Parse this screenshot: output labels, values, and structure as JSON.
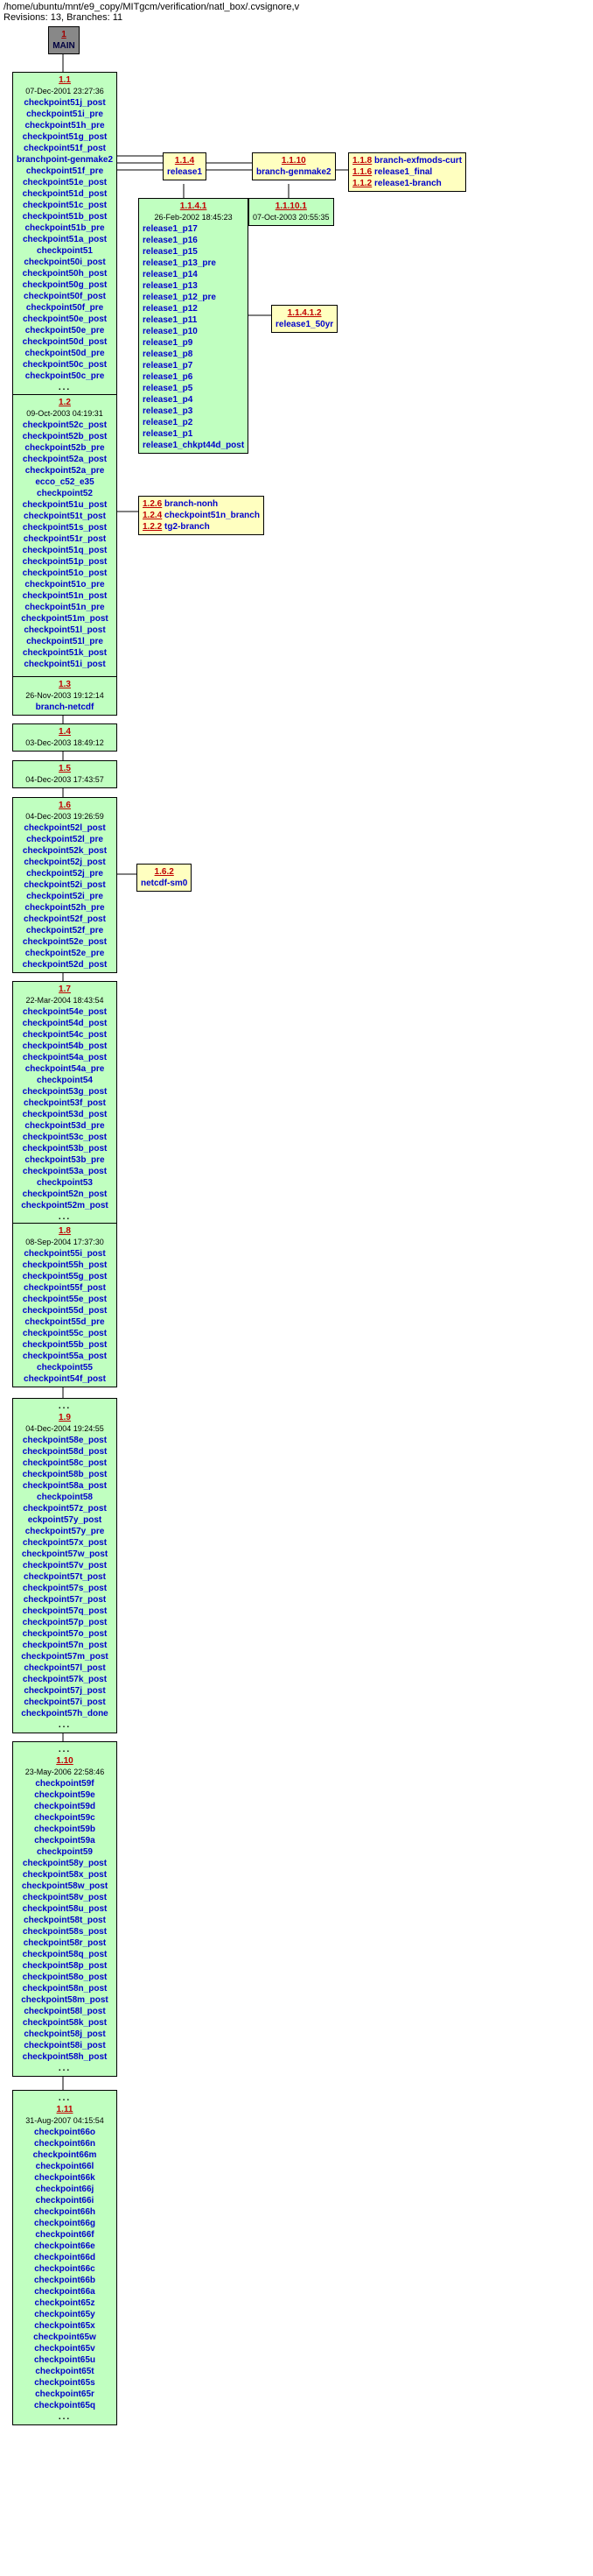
{
  "header": {
    "path": "/home/ubuntu/mnt/e9_copy/MITgcm/verification/natl_box/.cvsignore,v",
    "meta": "Revisions: 13, Branches: 11"
  },
  "main_box": {
    "num": "1",
    "label": "MAIN"
  },
  "chain": [
    {
      "id": "r1_1",
      "num": "1.1",
      "date": "07-Dec-2001 23:27:36",
      "tags": [
        "checkpoint51j_post",
        "checkpoint51i_pre",
        "checkpoint51h_pre",
        "checkpoint51g_post",
        "checkpoint51f_post",
        "branchpoint-genmake2",
        "checkpoint51f_pre",
        "checkpoint51e_post",
        "checkpoint51d_post",
        "checkpoint51c_post",
        "checkpoint51b_post",
        "checkpoint51b_pre",
        "checkpoint51a_post",
        "checkpoint51",
        "checkpoint50i_post",
        "checkpoint50h_post",
        "checkpoint50g_post",
        "checkpoint50f_post",
        "checkpoint50f_pre",
        "checkpoint50e_post",
        "checkpoint50e_pre",
        "checkpoint50d_post",
        "checkpoint50d_pre",
        "checkpoint50c_post",
        "checkpoint50c_pre"
      ]
    },
    {
      "id": "r1_2",
      "num": "1.2",
      "date": "09-Oct-2003 04:19:31",
      "tags": [
        "checkpoint52c_post",
        "checkpoint52b_post",
        "checkpoint52b_pre",
        "checkpoint52a_post",
        "checkpoint52a_pre",
        "ecco_c52_e35",
        "checkpoint52",
        "checkpoint51u_post",
        "checkpoint51t_post",
        "checkpoint51s_post",
        "checkpoint51r_post",
        "checkpoint51q_post",
        "checkpoint51p_post",
        "checkpoint51o_post",
        "checkpoint51o_pre",
        "checkpoint51n_post",
        "checkpoint51n_pre",
        "checkpoint51m_post",
        "checkpoint51l_post",
        "checkpoint51l_pre",
        "checkpoint51k_post",
        "checkpoint51i_post"
      ]
    },
    {
      "id": "r1_3",
      "num": "1.3",
      "date": "26-Nov-2003 19:12:14",
      "tags": [
        "branch-netcdf"
      ]
    },
    {
      "id": "r1_4",
      "num": "1.4",
      "date": "03-Dec-2003 18:49:12",
      "tags": []
    },
    {
      "id": "r1_5",
      "num": "1.5",
      "date": "04-Dec-2003 17:43:57",
      "tags": []
    },
    {
      "id": "r1_6",
      "num": "1.6",
      "date": "04-Dec-2003 19:26:59",
      "tags": [
        "checkpoint52l_post",
        "checkpoint52l_pre",
        "checkpoint52k_post",
        "checkpoint52j_post",
        "checkpoint52j_pre",
        "checkpoint52i_post",
        "checkpoint52i_pre",
        "checkpoint52h_pre",
        "checkpoint52f_post",
        "checkpoint52f_pre",
        "checkpoint52e_post",
        "checkpoint52e_pre",
        "checkpoint52d_post"
      ]
    },
    {
      "id": "r1_7",
      "num": "1.7",
      "date": "22-Mar-2004 18:43:54",
      "tags": [
        "checkpoint54e_post",
        "checkpoint54d_post",
        "checkpoint54c_post",
        "checkpoint54b_post",
        "checkpoint54a_post",
        "checkpoint54a_pre",
        "checkpoint54",
        "checkpoint53g_post",
        "checkpoint53f_post",
        "checkpoint53d_post",
        "checkpoint53d_pre",
        "checkpoint53c_post",
        "checkpoint53b_post",
        "checkpoint53b_pre",
        "checkpoint53a_post",
        "checkpoint53",
        "checkpoint52n_post",
        "checkpoint52m_post"
      ]
    },
    {
      "id": "r1_8",
      "num": "1.8",
      "date": "08-Sep-2004 17:37:30",
      "tags": [
        "checkpoint55i_post",
        "checkpoint55h_post",
        "checkpoint55g_post",
        "checkpoint55f_post",
        "checkpoint55e_post",
        "checkpoint55d_post",
        "checkpoint55d_pre",
        "checkpoint55c_post",
        "checkpoint55b_post",
        "checkpoint55a_post",
        "checkpoint55",
        "checkpoint54f_post"
      ]
    },
    {
      "id": "r1_9",
      "num": "1.9",
      "date": "04-Dec-2004 19:24:55",
      "tags": [
        "checkpoint58e_post",
        "checkpoint58d_post",
        "checkpoint58c_post",
        "checkpoint58b_post",
        "checkpoint58a_post",
        "checkpoint58",
        "checkpoint57z_post",
        "eckpoint57y_post",
        "checkpoint57y_pre",
        "checkpoint57x_post",
        "checkpoint57w_post",
        "checkpoint57v_post",
        "checkpoint57t_post",
        "checkpoint57s_post",
        "checkpoint57r_post",
        "checkpoint57q_post",
        "checkpoint57p_post",
        "checkpoint57o_post",
        "checkpoint57n_post",
        "checkpoint57m_post",
        "checkpoint57l_post",
        "checkpoint57k_post",
        "checkpoint57j_post",
        "checkpoint57i_post",
        "checkpoint57h_done"
      ]
    },
    {
      "id": "r1_10",
      "num": "1.10",
      "date": "23-May-2006 22:58:46",
      "tags": [
        "checkpoint59f",
        "checkpoint59e",
        "checkpoint59d",
        "checkpoint59c",
        "checkpoint59b",
        "checkpoint59a",
        "checkpoint59",
        "checkpoint58y_post",
        "checkpoint58x_post",
        "checkpoint58w_post",
        "checkpoint58v_post",
        "checkpoint58u_post",
        "checkpoint58t_post",
        "checkpoint58s_post",
        "checkpoint58r_post",
        "checkpoint58q_post",
        "checkpoint58p_post",
        "checkpoint58o_post",
        "checkpoint58n_post",
        "checkpoint58m_post",
        "checkpoint58l_post",
        "checkpoint58k_post",
        "checkpoint58j_post",
        "checkpoint58i_post",
        "checkpoint58h_post"
      ]
    },
    {
      "id": "r1_11",
      "num": "1.11",
      "date": "31-Aug-2007 04:15:54",
      "tags": [
        "checkpoint66o",
        "checkpoint66n",
        "checkpoint66m",
        "checkpoint66l",
        "checkpoint66k",
        "checkpoint66j",
        "checkpoint66i",
        "checkpoint66h",
        "checkpoint66g",
        "checkpoint66f",
        "checkpoint66e",
        "checkpoint66d",
        "checkpoint66c",
        "checkpoint66b",
        "checkpoint66a",
        "checkpoint65z",
        "checkpoint65y",
        "checkpoint65x",
        "checkpoint65w",
        "checkpoint65v",
        "checkpoint65u",
        "checkpoint65t",
        "checkpoint65s",
        "checkpoint65r",
        "checkpoint65q"
      ]
    }
  ],
  "branches": {
    "r114": {
      "num": "1.1.4",
      "label": "release1"
    },
    "r1141": {
      "num": "1.1.4.1",
      "date": "26-Feb-2002 18:45:23",
      "tags": [
        "release1_p17",
        "release1_p16",
        "release1_p15",
        "release1_p13_pre",
        "release1_p14",
        "release1_p13",
        "release1_p12_pre",
        "release1_p12",
        "release1_p11",
        "release1_p10",
        "release1_p9",
        "release1_p8",
        "release1_p7",
        "release1_p6",
        "release1_p5",
        "release1_p4",
        "release1_p3",
        "release1_p2",
        "release1_p1",
        "release1_chkpt44d_post"
      ]
    },
    "r1110": {
      "num": "1.1.10",
      "label": "branch-genmake2"
    },
    "r11101": {
      "num": "1.1.10.1",
      "date": "07-Oct-2003 20:55:35",
      "tags": []
    },
    "r11412": {
      "num": "1.1.4.1.2",
      "label": "release1_50yr"
    },
    "r11_text": {
      "lines": [
        "1.1.8 branch-exfmods-curt",
        "1.1.6 release1_final",
        "1.1.2 release1-branch"
      ]
    },
    "r12_text": {
      "lines": [
        "1.2.6 branch-nonh",
        "1.2.4 checkpoint51n_branch",
        "1.2.2 tg2-branch"
      ]
    },
    "r162": {
      "num": "1.6.2",
      "label": "netcdf-sm0"
    }
  },
  "chart_data": {
    "type": "tree",
    "description": "CVS revision graph",
    "nodes": [
      {
        "id": "MAIN",
        "rev": "1"
      },
      {
        "id": "1.1"
      },
      {
        "id": "1.2"
      },
      {
        "id": "1.3"
      },
      {
        "id": "1.4"
      },
      {
        "id": "1.5"
      },
      {
        "id": "1.6"
      },
      {
        "id": "1.7"
      },
      {
        "id": "1.8"
      },
      {
        "id": "1.9"
      },
      {
        "id": "1.10"
      },
      {
        "id": "1.11"
      },
      {
        "id": "1.1.4"
      },
      {
        "id": "1.1.4.1"
      },
      {
        "id": "1.1.10"
      },
      {
        "id": "1.1.10.1"
      },
      {
        "id": "1.1.4.1.2"
      },
      {
        "id": "1.1.2/1.1.6/1.1.8"
      },
      {
        "id": "1.6.2"
      },
      {
        "id": "1.2.2/1.2.4/1.2.6"
      }
    ],
    "edges": [
      [
        "MAIN",
        "1.1"
      ],
      [
        "1.1",
        "1.2"
      ],
      [
        "1.2",
        "1.3"
      ],
      [
        "1.3",
        "1.4"
      ],
      [
        "1.4",
        "1.5"
      ],
      [
        "1.5",
        "1.6"
      ],
      [
        "1.6",
        "1.7"
      ],
      [
        "1.7",
        "1.8"
      ],
      [
        "1.8",
        "1.9"
      ],
      [
        "1.9",
        "1.10"
      ],
      [
        "1.10",
        "1.11"
      ],
      [
        "1.1",
        "1.1.4"
      ],
      [
        "1.1.4",
        "1.1.4.1"
      ],
      [
        "1.1",
        "1.1.10"
      ],
      [
        "1.1.10",
        "1.1.10.1"
      ],
      [
        "1.1.4.1",
        "1.1.4.1.2"
      ],
      [
        "1.1",
        "1.1.2/1.1.6/1.1.8"
      ],
      [
        "1.6",
        "1.6.2"
      ],
      [
        "1.2",
        "1.2.2/1.2.4/1.2.6"
      ]
    ]
  }
}
